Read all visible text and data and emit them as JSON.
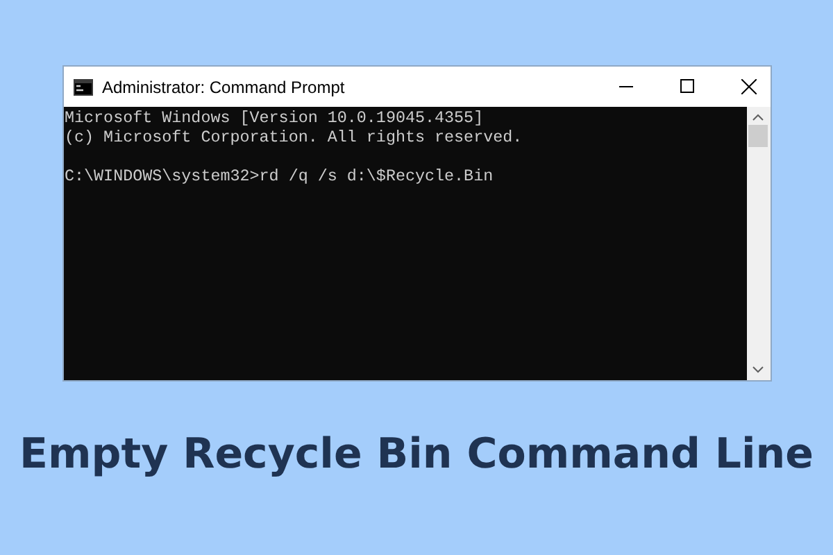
{
  "window": {
    "title": "Administrator: Command Prompt"
  },
  "console": {
    "header_lines": [
      "Microsoft Windows [Version 10.0.19045.4355]",
      "(c) Microsoft Corporation. All rights reserved."
    ],
    "prompt": "C:\\WINDOWS\\system32>",
    "command": "rd /q /s d:\\$Recycle.Bin"
  },
  "caption": "Empty Recycle Bin Command Line"
}
